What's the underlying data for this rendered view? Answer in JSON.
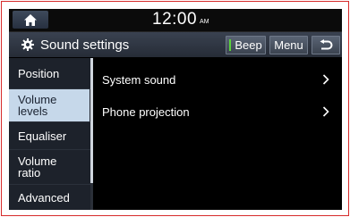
{
  "status_bar": {
    "time": "12:00",
    "ampm": "AM"
  },
  "header": {
    "title": "Sound settings",
    "beep_label": "Beep",
    "menu_label": "Menu"
  },
  "sidebar": {
    "items": [
      {
        "label": "Position",
        "selected": false
      },
      {
        "label": "Volume\nlevels",
        "selected": true
      },
      {
        "label": "Equaliser",
        "selected": false
      },
      {
        "label": "Volume\nratio",
        "selected": false
      },
      {
        "label": "Advanced",
        "selected": false
      }
    ]
  },
  "content": {
    "rows": [
      {
        "label": "System sound"
      },
      {
        "label": "Phone projection"
      }
    ]
  },
  "colors": {
    "accent_selected": "#c6d8ea",
    "beep_indicator": "#5ad23c",
    "frame_border": "#d72b2b"
  },
  "icons": [
    "home-icon",
    "gear-icon",
    "back-arrow-icon",
    "chevron-right-icon"
  ]
}
